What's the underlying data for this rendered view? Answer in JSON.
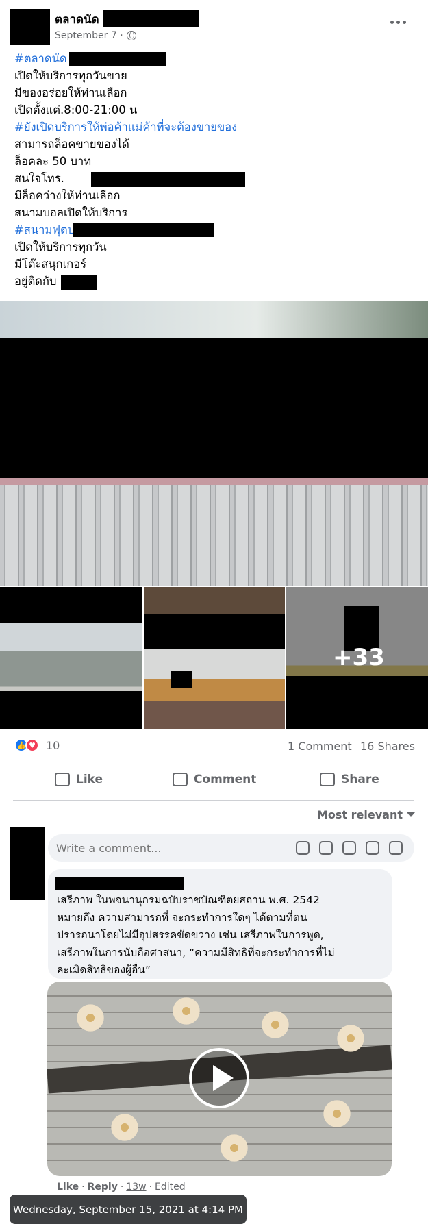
{
  "post": {
    "page_name": "ตลาดนัด",
    "date": "September 7 ·",
    "lines": [
      {
        "text": "#ตลาดนัด",
        "hashtag": true
      },
      {
        "text": "เปิดให้บริการทุกวันขาย",
        "hashtag": false
      },
      {
        "text": "มีของอร่อยให้ท่านเลือก",
        "hashtag": false
      },
      {
        "text": "เปิดตั้งแต่.8:00-21:00 น",
        "hashtag": false
      },
      {
        "text": "#ยังเปิดบริการให้พ่อค้าแม่ค้าที่จะต้องขายของ",
        "hashtag": true
      },
      {
        "text": "สามารถล็อคขายของได้",
        "hashtag": false
      },
      {
        "text": "ล็อคละ 50 บาท",
        "hashtag": false
      },
      {
        "text": "สนใจโทร.",
        "hashtag": false
      },
      {
        "text": "มีล็อคว่างให้ท่านเลือก",
        "hashtag": false
      },
      {
        "text": "สนามบอลเปิดให้บริการ",
        "hashtag": false
      },
      {
        "text": "#สนามฟุตบอล",
        "hashtag": true
      },
      {
        "text": "เปิดให้บริการทุกวัน",
        "hashtag": false
      },
      {
        "text": "มีโต๊ะสนุกเกอร์",
        "hashtag": false
      },
      {
        "text": "อยู่ติดกับ",
        "hashtag": false
      }
    ],
    "more_photos": "+33"
  },
  "stats": {
    "reaction_count": "10",
    "comments": "1 Comment",
    "shares": "16 Shares"
  },
  "actions": {
    "like": "Like",
    "comment": "Comment",
    "share": "Share"
  },
  "comments_section": {
    "sort_label": "Most relevant",
    "input_placeholder": "Write a comment...",
    "comment": {
      "lines": [
        "เสรีภาพ ในพจนานุกรมฉบับราชบัณฑิตยสถาน พ.ศ. 2542",
        "หมายถึง ความสามารถที่ จะกระทำการใดๆ ได้ตามที่ตน",
        "ปรารถนาโดยไม่มีอุปสรรคขัดขวาง เช่น เสรีภาพในการพูด,",
        "เสรีภาพในการนับถือศาสนา, “ความมีสิทธิที่จะกระทำการที่ไม่",
        "ละเมิดสิทธิของผู้อื่น”"
      ],
      "like": "Like",
      "reply": "Reply",
      "time": "13w",
      "edited": "Edited"
    }
  },
  "tooltip": "Wednesday, September 15, 2021 at 4:14 PM",
  "colors": {
    "hashtag": "#216fdb",
    "secondary_text": "#65676b",
    "like_blue": "#1877f2",
    "love_red": "#f33e58"
  }
}
